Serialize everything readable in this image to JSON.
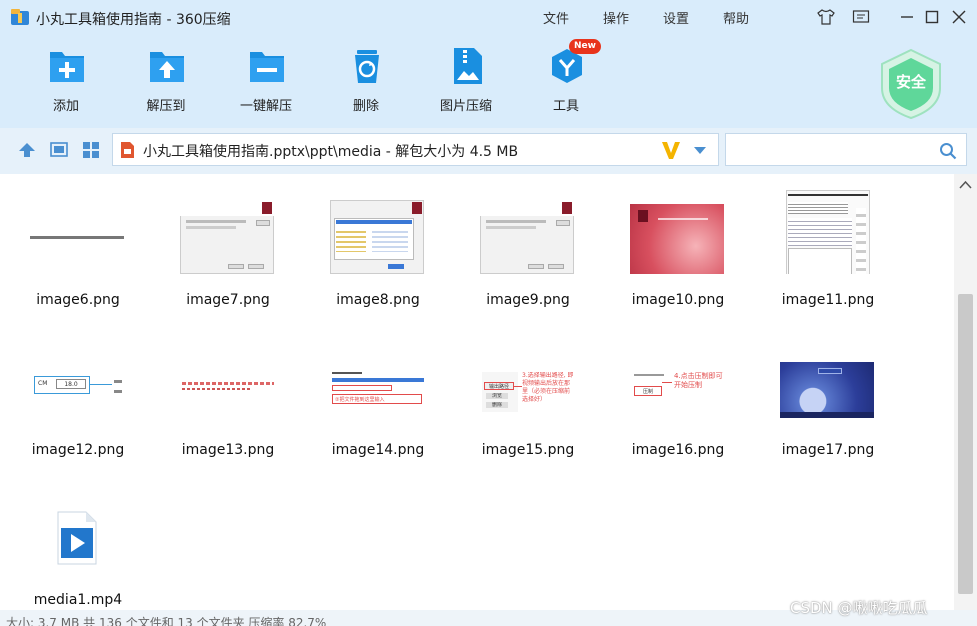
{
  "window": {
    "title": "小丸工具箱使用指南 - 360压缩",
    "menu": [
      "文件",
      "操作",
      "设置",
      "帮助"
    ],
    "icons": [
      "skin-icon",
      "feedback-icon",
      "minimize-icon",
      "maximize-icon",
      "close-icon"
    ]
  },
  "toolbar": {
    "tools": [
      {
        "label": "添加",
        "icon": "add-icon"
      },
      {
        "label": "解压到",
        "icon": "extract-to-icon"
      },
      {
        "label": "一键解压",
        "icon": "one-click-extract-icon"
      },
      {
        "label": "删除",
        "icon": "delete-icon"
      },
      {
        "label": "图片压缩",
        "icon": "image-compress-icon"
      },
      {
        "label": "工具",
        "icon": "tools-icon",
        "badge": "New"
      }
    ],
    "security_label": "安全"
  },
  "addressbar": {
    "path": "小丸工具箱使用指南.pptx\\ppt\\media - 解包大小为 4.5 MB",
    "search_value": ""
  },
  "files": [
    {
      "name": "image6.png"
    },
    {
      "name": "image7.png"
    },
    {
      "name": "image8.png"
    },
    {
      "name": "image9.png"
    },
    {
      "name": "image10.png"
    },
    {
      "name": "image11.png"
    },
    {
      "name": "image12.png"
    },
    {
      "name": "image13.png"
    },
    {
      "name": "image14.png"
    },
    {
      "name": "image15.png"
    },
    {
      "name": "image16.png"
    },
    {
      "name": "image17.png"
    },
    {
      "name": "media1.mp4"
    }
  ],
  "thumb_text": {
    "t12_value": "18.0",
    "t14_note": "②把文件拖到这里输入",
    "t15_btn1": "输出路径",
    "t15_btn2": "浏览",
    "t15_btn3": "删除",
    "t15_note": "3.选择输出路径, 即视频输出后放在那里（必须在压缩前选择好）",
    "t16_btn": "压制",
    "t16_note": "4.点击压制即可开始压制"
  },
  "status": {
    "text": "大小: 3.7 MB 共 136 个文件和 13 个文件夹 压缩率 82.7%",
    "watermark": "CSDN @啾啾吃瓜瓜"
  },
  "colors": {
    "accent": "#1a8fe0",
    "toolbar_bg": "#d9ecfb",
    "addressbar_bg": "#e6f1fa",
    "badge": "#e8341c",
    "shield": "#5fd79a"
  }
}
